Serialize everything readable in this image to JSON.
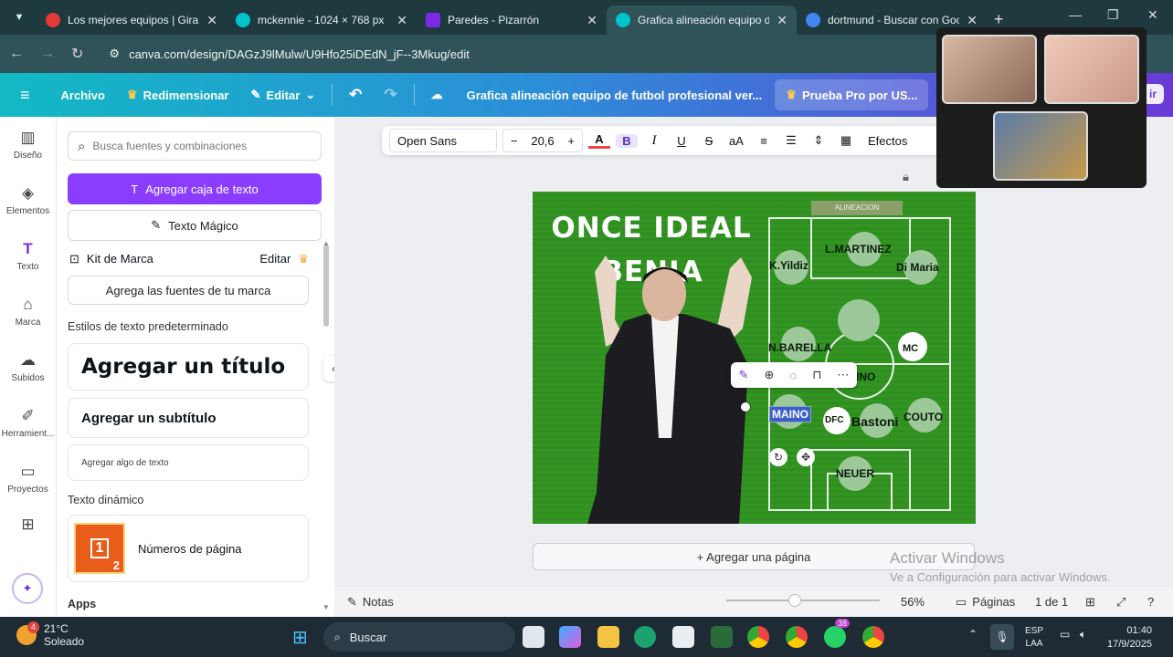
{
  "browser": {
    "tabs": [
      {
        "title": "Los mejores equipos | Gira la",
        "favicon_color": "#e53935",
        "active": false
      },
      {
        "title": "mckennie - 1024 × 768 px",
        "favicon_color": "#00c4cc",
        "active": false
      },
      {
        "title": "Paredes - Pizarrón",
        "favicon_color": "#7d2ae8",
        "active": false
      },
      {
        "title": "Grafica alineación equipo de",
        "favicon_color": "#00c4cc",
        "active": true
      },
      {
        "title": "dortmund - Buscar con Goo",
        "favicon_color": "#4285f4",
        "active": false
      }
    ],
    "url": "canva.com/design/DAGzJ9lMulw/U9Hfo25iDEdN_jF--3Mkug/edit"
  },
  "canva_header": {
    "archivo": "Archivo",
    "redimensionar": "Redimensionar",
    "editar": "Editar",
    "doc_title": "Grafica alineación equipo de futbol profesional ver...",
    "pro_button": "Prueba Pro por US...",
    "share_partial": "ir"
  },
  "rail": [
    {
      "label": "Diseño",
      "icon": "layout-icon"
    },
    {
      "label": "Elementos",
      "icon": "shapes-icon"
    },
    {
      "label": "Texto",
      "icon": "text-icon"
    },
    {
      "label": "Marca",
      "icon": "brand-icon"
    },
    {
      "label": "Subidos",
      "icon": "upload-cloud-icon"
    },
    {
      "label": "Herramient...",
      "icon": "tools-icon"
    },
    {
      "label": "Proyectos",
      "icon": "folder-icon"
    },
    {
      "label": "Apps",
      "icon": "apps-icon"
    }
  ],
  "panel": {
    "search_placeholder": "Busca fuentes y combinaciones",
    "add_textbox": "Agregar caja de texto",
    "magic_text": "Texto Mágico",
    "brand_kit": "Kit de Marca",
    "brand_edit": "Editar",
    "add_brand_fonts": "Agrega las fuentes de tu marca",
    "default_styles": "Estilos de texto predeterminado",
    "add_title": "Agregar un título",
    "add_subtitle": "Agregar un subtítulo",
    "add_body": "Agregar algo de texto",
    "dynamic_text": "Texto dinámico",
    "page_numbers": "Números de página",
    "page_thumb_a": "1",
    "page_thumb_b": "2",
    "apps": "Apps"
  },
  "toolbar": {
    "font": "Open Sans",
    "size": "20,6",
    "minus": "−",
    "plus": "+",
    "bold": "B",
    "italic": "I",
    "underline": "U",
    "strike": "S",
    "case": "aA",
    "effects": "Efectos"
  },
  "canvas": {
    "title_1": "ONCE IDEAL",
    "title_2": "BENJA",
    "alineacion": "ALINEACION",
    "players": {
      "martinez": "L.MARTINEZ",
      "yildiz": "K.Yildiz",
      "dimaria": "Di Maria",
      "barella": "N.BARELLA",
      "mc": "MC",
      "ino": "INO",
      "maino": "MAINO",
      "dfc": "DFC",
      "bastoni": "Bastoni",
      "couto": "COUTO",
      "neuer": "NEUER"
    }
  },
  "add_page": "+ Agregar una página",
  "watermark": {
    "line1": "Activar Windows",
    "line2": "Ve a Configuración para activar Windows."
  },
  "footer": {
    "notes": "Notas",
    "zoom": "56%",
    "pages": "Páginas",
    "page_count": "1 de 1"
  },
  "taskbar": {
    "temp": "21°C",
    "weather": "Soleado",
    "weather_badge": "4",
    "search": "Buscar",
    "lang_1": "ESP",
    "lang_2": "LAA",
    "time": "01:40",
    "date": "17/9/2025",
    "whatsapp_badge": "38"
  }
}
